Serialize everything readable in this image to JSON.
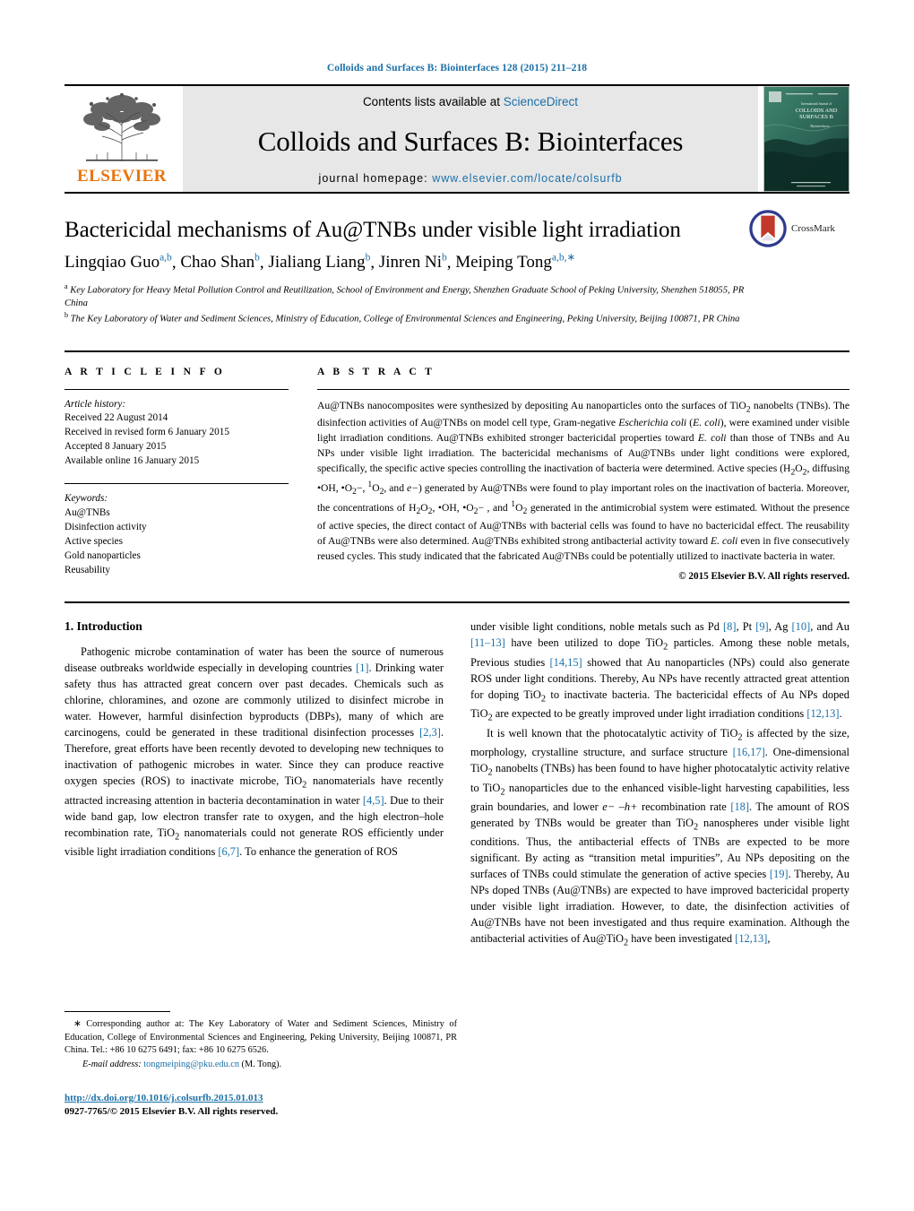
{
  "running_head": "Colloids and Surfaces B: Biointerfaces 128 (2015) 211–218",
  "masthead": {
    "publisher_name": "ELSEVIER",
    "contents_prefix": "Contents lists available at ",
    "contents_link": "ScienceDirect",
    "journal_title": "Colloids and Surfaces B: Biointerfaces",
    "homepage_label": "journal homepage:",
    "homepage_url": "www.elsevier.com/locate/colsurfb",
    "cover_line1": "International Journal of",
    "cover_line2": "COLLOIDS AND",
    "cover_line3": "SURFACES B",
    "cover_sub": "Biointerfaces"
  },
  "article": {
    "title": "Bactericidal mechanisms of Au@TNBs under visible light irradiation",
    "crossmark_label": "CrossMark",
    "authors": [
      {
        "name": "Lingqiao Guo",
        "sup": "a,b",
        "sep": ", "
      },
      {
        "name": "Chao Shan",
        "sup": "b",
        "sep": ", "
      },
      {
        "name": "Jialiang Liang",
        "sup": "b",
        "sep": ", "
      },
      {
        "name": "Jinren Ni",
        "sup": "b",
        "sep": ", "
      },
      {
        "name": "Meiping Tong",
        "sup": "a,b,",
        "sup_star": "∗",
        "sep": ""
      }
    ],
    "affiliations": [
      {
        "mark": "a",
        "text": "Key Laboratory for Heavy Metal Pollution Control and Reutilization, School of Environment and Energy, Shenzhen Graduate School of Peking University, Shenzhen 518055, PR China"
      },
      {
        "mark": "b",
        "text": "The Key Laboratory of Water and Sediment Sciences, Ministry of Education, College of Environmental Sciences and Engineering, Peking University, Beijing 100871, PR China"
      }
    ]
  },
  "article_info": {
    "heading": "A R T I C L E   I N F O",
    "history_title": "Article history:",
    "history": [
      "Received 22 August 2014",
      "Received in revised form 6 January 2015",
      "Accepted 8 January 2015",
      "Available online 16 January 2015"
    ],
    "keywords_title": "Keywords:",
    "keywords": [
      "Au@TNBs",
      "Disinfection activity",
      "Active species",
      "Gold nanoparticles",
      "Reusability"
    ]
  },
  "abstract": {
    "heading": "A B S T R A C T",
    "paragraph_1": "Au@TNBs nanocomposites were synthesized by depositing Au nanoparticles onto the surfaces of TiO",
    "paragraph_2": " nanobelts (TNBs). The disinfection activities of Au@TNBs on model cell type, Gram-negative ",
    "ecoli_full": "Escherichia coli",
    "paragraph_3": " (",
    "ecoli_short": "E. coli",
    "paragraph_4": "), were examined under visible light irradiation conditions. Au@TNBs exhibited stronger bactericidal properties toward ",
    "ecoli_short2": "E. coli",
    "paragraph_5": " than those of TNBs and Au NPs under visible light irradiation. The bactericidal mechanisms of Au@TNBs under light conditions were explored, specifically, the specific active species controlling the inactivation of bacteria were determined. Active species (H",
    "paragraph_6": "O",
    "paragraph_7": ", diffusing •OH, •O",
    "paragraph_8": "−, ",
    "paragraph_9": "O",
    "paragraph_10": ", and ",
    "electron": "e−",
    "paragraph_11": ") generated by Au@TNBs were found to play important roles on the inactivation of bacteria. Moreover, the concentrations of H",
    "paragraph_12": "O",
    "paragraph_13": ", •OH, •O",
    "paragraph_14": "− , and ",
    "paragraph_15": "O",
    "paragraph_16": " generated in the antimicrobial system were estimated. Without the presence of active species, the direct contact of Au@TNBs with bacterial cells was found to have no bactericidal effect. The reusability of Au@TNBs were also determined. Au@TNBs exhibited strong antibacterial activity toward ",
    "ecoli_short3": "E. coli",
    "paragraph_17": " even in five consecutively reused cycles. This study indicated that the fabricated Au@TNBs could be potentially utilized to inactivate bacteria in water.",
    "copyright": "© 2015 Elsevier B.V. All rights reserved."
  },
  "introduction": {
    "heading": "1.  Introduction",
    "left_p1_a": "Pathogenic microbe contamination of water has been the source of numerous disease outbreaks worldwide especially in developing countries ",
    "left_ref1": "[1]",
    "left_p1_b": ". Drinking water safety thus has attracted great concern over past decades. Chemicals such as chlorine, chloramines, and ozone are commonly utilized to disinfect microbe in water. However, harmful disinfection byproducts (DBPs), many of which are carcinogens, could be generated in these traditional disinfection processes ",
    "left_ref2": "[2,3]",
    "left_p1_c": ". Therefore, great efforts have been recently devoted to developing new techniques to inactivation of pathogenic microbes in water. Since they can produce reactive oxygen species (ROS) to inactivate microbe, TiO",
    "left_p1_d": " nanomaterials have recently attracted increasing attention in bacteria decontamination in water ",
    "left_ref3": "[4,5]",
    "left_p1_e": ". Due to their wide band gap, low electron transfer rate to oxygen, and the high electron–hole recombination rate, TiO",
    "left_p1_f": " nanomaterials could not generate ROS efficiently under visible light irradiation conditions ",
    "left_ref4": "[6,7]",
    "left_p1_g": ". To enhance the generation of ROS",
    "right_p1_a": "under visible light conditions, noble metals such as Pd ",
    "right_ref8": "[8]",
    "right_p1_b": ", Pt ",
    "right_ref9": "[9]",
    "right_p1_c": ", Ag ",
    "right_ref10": "[10]",
    "right_p1_d": ", and Au ",
    "right_ref1113": "[11–13]",
    "right_p1_e": " have been utilized to dope TiO",
    "right_p1_f": " particles. Among these noble metals, Previous studies ",
    "right_ref1415": "[14,15]",
    "right_p1_g": " showed that Au nanoparticles (NPs) could also generate ROS under light conditions. Thereby, Au NPs have recently attracted great attention for doping TiO",
    "right_p1_h": " to inactivate bacteria. The bactericidal effects of Au NPs doped TiO",
    "right_p1_i": " are expected to be greatly improved under light irradiation conditions ",
    "right_ref1213": "[12,13]",
    "right_p1_j": ".",
    "right_p2_a": "It is well known that the photocatalytic activity of TiO",
    "right_p2_b": " is affected by the size, morphology, crystalline structure, and surface structure ",
    "right_ref1617": "[16,17]",
    "right_p2_c": ". One-dimensional TiO",
    "right_p2_d": " nanobelts (TNBs) has been found to have higher photocatalytic activity relative to TiO",
    "right_p2_e": " nanoparticles due to the enhanced visible-light harvesting capabilities, less grain boundaries, and lower ",
    "right_p2_ital": "e− –h+",
    "right_p2_f": " recombination rate ",
    "right_ref18": "[18]",
    "right_p2_g": ". The amount of ROS generated by TNBs would be greater than TiO",
    "right_p2_h": " nanospheres under visible light conditions. Thus, the antibacterial effects of TNBs are expected to be more significant. By acting as “transition metal impurities”, Au NPs depositing on the surfaces of TNBs could stimulate the generation of active species ",
    "right_ref19": "[19]",
    "right_p2_i": ". Thereby, Au NPs doped TNBs (Au@TNBs) are expected to have improved bactericidal property under visible light irradiation. However, to date, the disinfection activities of Au@TNBs have not been investigated and thus require examination. Although the antibacterial activities of Au@TiO",
    "right_p2_j": " have been investigated ",
    "right_ref1213b": "[12,13]",
    "right_p2_k": ","
  },
  "footnote": {
    "star": "∗",
    "text": " Corresponding author at: The Key Laboratory of Water and Sediment Sciences, Ministry of Education, College of Environmental Sciences and Engineering, Peking University, Beijing 100871, PR China. Tel.: +86 10 6275 6491; fax: +86 10 6275 6526.",
    "email_label": "E-mail address:",
    "email": "tongmeiping@pku.edu.cn",
    "email_suffix": " (M. Tong)."
  },
  "footer": {
    "doi": "http://dx.doi.org/10.1016/j.colsurfb.2015.01.013",
    "issn": "0927-7765/© 2015 Elsevier B.V. All rights reserved."
  },
  "colors": {
    "link": "#1a6fa8",
    "elsevier_orange": "#e8730d",
    "cover_green": "#2e6f5e"
  }
}
